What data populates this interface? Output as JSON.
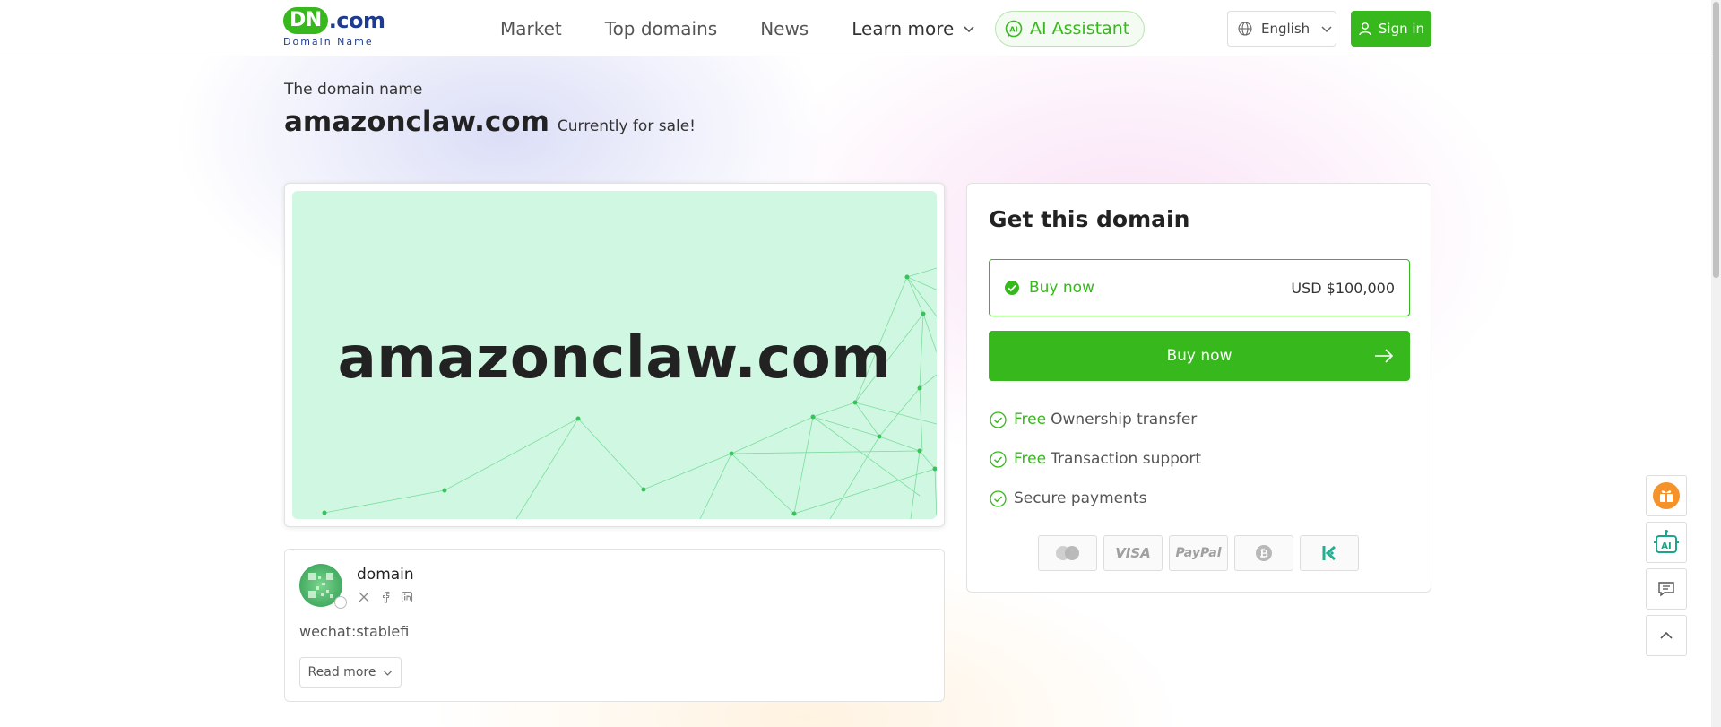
{
  "header": {
    "logo_main_dn": "DN",
    "logo_main_com": ".com",
    "logo_sub": "Domain Name",
    "nav": [
      "Market",
      "Top domains",
      "News",
      "Learn more"
    ],
    "ai_assistant": "AI Assistant",
    "language": "English",
    "sign_in": "Sign in"
  },
  "page": {
    "subtitle": "The domain name",
    "domain": "amazonclaw.com",
    "sale_note": "Currently for sale!"
  },
  "preview": {
    "domain": "amazonclaw.com"
  },
  "seller": {
    "name": "domain",
    "description": "wechat:stablefi",
    "read_more": "Read more",
    "socials": [
      "x-icon",
      "facebook-icon",
      "linkedin-icon"
    ]
  },
  "purchase": {
    "title": "Get this domain",
    "option_label": "Buy now",
    "option_price": "USD $100,000",
    "button": "Buy now",
    "features": [
      {
        "free": "Free",
        "text": "Ownership transfer"
      },
      {
        "free": "Free",
        "text": "Transaction support"
      },
      {
        "free": "",
        "text": "Secure payments"
      }
    ],
    "payments": [
      "mastercard",
      "VISA",
      "PayPal",
      "bitcoin",
      "kucoin"
    ]
  },
  "colors": {
    "brand_green": "#37b81d",
    "brand_blue": "#1f3b8f",
    "preview_bg": "#d0f7e2"
  }
}
